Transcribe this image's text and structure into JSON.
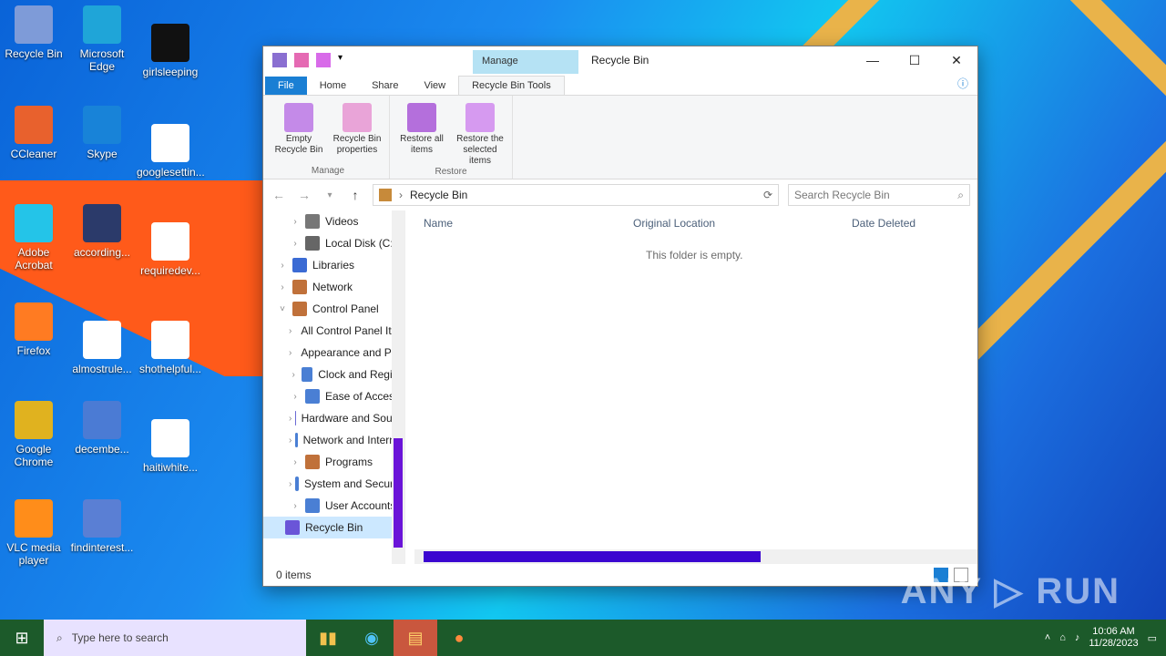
{
  "desktop": {
    "icons": [
      {
        "label": "Recycle Bin"
      },
      {
        "label": "Microsoft Edge"
      },
      {
        "label": "girlsleeping"
      },
      {
        "label": "CCleaner"
      },
      {
        "label": "Skype"
      },
      {
        "label": "googlesettin..."
      },
      {
        "label": "Adobe Acrobat"
      },
      {
        "label": "according..."
      },
      {
        "label": "requiredev..."
      },
      {
        "label": "Firefox"
      },
      {
        "label": "almostrule..."
      },
      {
        "label": "shothelpful..."
      },
      {
        "label": "Google Chrome"
      },
      {
        "label": "decembe..."
      },
      {
        "label": "haitiwhite..."
      },
      {
        "label": "VLC media player"
      },
      {
        "label": "findinterest..."
      }
    ]
  },
  "window": {
    "title": "Recycle Bin",
    "tool_tab": "Manage",
    "controls": {
      "minimize": "—",
      "maximize": "☐",
      "close": "✕"
    },
    "ribbon_tabs": [
      "File",
      "Home",
      "Share",
      "View",
      "Recycle Bin Tools"
    ],
    "ribbon_groups": [
      {
        "label": "Manage",
        "buttons": [
          "Empty Recycle Bin",
          "Recycle Bin properties"
        ]
      },
      {
        "label": "Restore",
        "buttons": [
          "Restore all items",
          "Restore the selected items"
        ]
      }
    ],
    "address": {
      "path": "Recycle Bin",
      "search_placeholder": "Search Recycle Bin"
    },
    "nav_tree": [
      {
        "label": "Videos"
      },
      {
        "label": "Local Disk (C:)"
      },
      {
        "label": "Libraries"
      },
      {
        "label": "Network"
      },
      {
        "label": "Control Panel"
      },
      {
        "label": "All Control Panel Items"
      },
      {
        "label": "Appearance and Personalization"
      },
      {
        "label": "Clock and Region"
      },
      {
        "label": "Ease of Access"
      },
      {
        "label": "Hardware and Sound"
      },
      {
        "label": "Network and Internet"
      },
      {
        "label": "Programs"
      },
      {
        "label": "System and Security"
      },
      {
        "label": "User Accounts"
      },
      {
        "label": "Recycle Bin"
      }
    ],
    "columns": [
      "Name",
      "Original Location",
      "Date Deleted"
    ],
    "empty_message": "This folder is empty.",
    "status": "0 items"
  },
  "taskbar": {
    "search_placeholder": "Type here to search",
    "time": "10:06 AM",
    "date": "11/28/2023"
  },
  "watermark": "ANY ▷ RUN"
}
